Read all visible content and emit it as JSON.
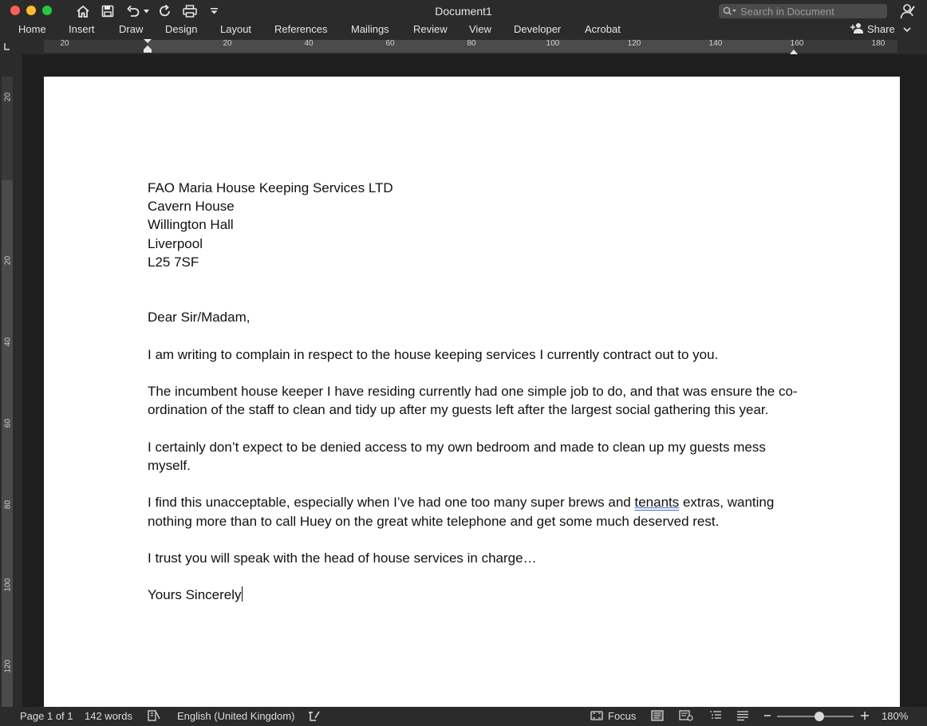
{
  "window": {
    "title": "Document1"
  },
  "search": {
    "placeholder": "Search in Document"
  },
  "ribbon": {
    "tabs": [
      "Home",
      "Insert",
      "Draw",
      "Design",
      "Layout",
      "References",
      "Mailings",
      "Review",
      "View",
      "Developer",
      "Acrobat"
    ],
    "share_label": "Share"
  },
  "ruler": {
    "h_labels": [
      "20",
      "20",
      "40",
      "60",
      "80",
      "100",
      "120",
      "140",
      "160",
      "180"
    ],
    "v_labels": [
      "20",
      "20",
      "40",
      "60",
      "80",
      "100",
      "120"
    ]
  },
  "document": {
    "address": [
      "FAO Maria House Keeping Services LTD",
      "Cavern House",
      "Willington Hall",
      "Liverpool",
      "L25 7SF"
    ],
    "greeting": "Dear Sir/Madam,",
    "para1": "I am writing to complain in respect to the house keeping services I currently contract out to you.",
    "para2": "The incumbent house keeper I have residing currently had one simple job to do, and that was ensure the co-ordination of the staff to clean and tidy up after my guests left after the largest social gathering this year.",
    "para3": "I certainly don’t expect to be denied access to my own bedroom and made to clean up my guests mess myself.",
    "para4_before": "I find this unacceptable, especially when I’ve had one too many super brews and ",
    "para4_flag": "tenants",
    "para4_after": " extras, wanting nothing more than to call Huey on the great white telephone and get some much deserved rest.",
    "para5": "I trust you will speak with the head of house services in charge…",
    "closing": "Yours Sincerely"
  },
  "status": {
    "page": "Page 1 of 1",
    "words": "142 words",
    "language": "English (United Kingdom)",
    "focus": "Focus",
    "zoom": "180%",
    "zoom_fraction": 0.55
  },
  "colors": {
    "chrome": "#2b2b2b",
    "canvas": "#1e1e1e",
    "page": "#ffffff",
    "spellcheck": "#3a6fd8"
  }
}
